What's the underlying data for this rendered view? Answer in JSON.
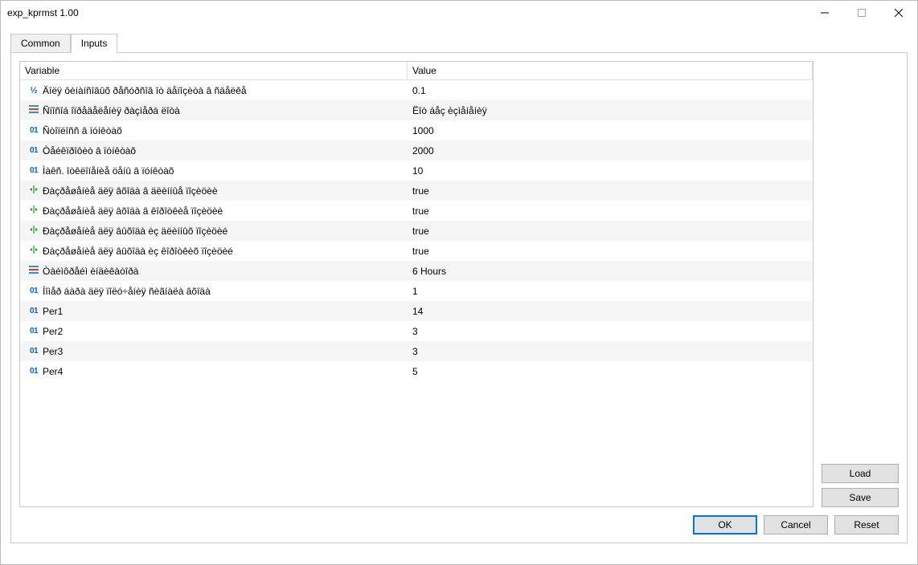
{
  "window": {
    "title": "exp_kprmst 1.00"
  },
  "tabs": {
    "common": "Common",
    "inputs": "Inputs"
  },
  "columns": {
    "variable": "Variable",
    "value": "Value"
  },
  "rows": [
    {
      "icon": "half",
      "name": "Äîëÿ ôèíàíñîâûõ ðåñóðñîâ îò äåïîçèòà â ñäåëêå",
      "value": "0.1"
    },
    {
      "icon": "enum",
      "name": "Ñïîñîá îïðåäåëåíèÿ ðàçìåðà ëîòà",
      "value": "Ëîò áåç èçìåíåíèÿ"
    },
    {
      "icon": "int",
      "name": "Ñòîïëîññ â ïóíêòàõ",
      "value": "1000"
    },
    {
      "icon": "int",
      "name": "Òåéêïðîôèò â ïóíêòàõ",
      "value": "2000"
    },
    {
      "icon": "int",
      "name": "Ìàêñ. îòêëîíåíèå öåíû â ïóíêòàõ",
      "value": "10"
    },
    {
      "icon": "bool",
      "name": "Ðàçðåøåíèå äëÿ âõîäà â äëèííûå ïîçèöèè",
      "value": "true"
    },
    {
      "icon": "bool",
      "name": "Ðàçðåøåíèå äëÿ âõîäà â êîðîòêèå ïîçèöèè",
      "value": "true"
    },
    {
      "icon": "bool",
      "name": "Ðàçðåøåíèå äëÿ âûõîäà èç äëèííûõ ïîçèöèé",
      "value": "true"
    },
    {
      "icon": "bool",
      "name": "Ðàçðåøåíèå äëÿ âûõîäà èç êîðîòêèõ ïîçèöèé",
      "value": "true"
    },
    {
      "icon": "enum",
      "name": "Òàéìôðåéì èíäèêàòîðà",
      "value": "6 Hours"
    },
    {
      "icon": "int",
      "name": "Íîìåð áàðà äëÿ ïîëó÷åíèÿ ñèãíàëà âõîäà",
      "value": "1"
    },
    {
      "icon": "int",
      "name": "Per1",
      "value": "14"
    },
    {
      "icon": "int",
      "name": "Per2",
      "value": "3"
    },
    {
      "icon": "int",
      "name": "Per3",
      "value": "3"
    },
    {
      "icon": "int",
      "name": "Per4",
      "value": "5"
    }
  ],
  "buttons": {
    "load": "Load",
    "save": "Save",
    "ok": "OK",
    "cancel": "Cancel",
    "reset": "Reset"
  }
}
